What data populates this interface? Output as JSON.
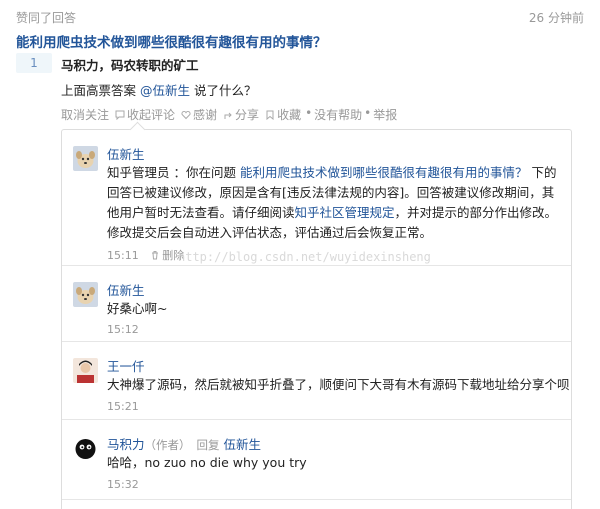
{
  "activity": {
    "label": "赞同了回答",
    "time": "26 分钟前"
  },
  "question": {
    "title": "能利用爬虫技术做到哪些很酷很有趣很有用的事情？"
  },
  "answer": {
    "votes": "1",
    "author": "马积力，码农转职的矿工",
    "text_prefix": "上面高票答案 ",
    "mention": "@伍新生",
    "text_suffix": " 说了什么？"
  },
  "actions": {
    "unfollow": "取消关注",
    "collapse_comments": "收起评论",
    "thanks": "感谢",
    "share": "分享",
    "favorite": "收藏",
    "dot": "•",
    "no_help": "没有帮助",
    "report": "举报"
  },
  "comments": [
    {
      "author": "伍新生",
      "text_a": "知乎管理员 ：你在问题 ",
      "link_a": "能利用爬虫技术做到哪些很酷很有趣很有用的事情？",
      "text_b": " 下的回答已被建议修改，原因是含有[违反法律法规的内容]。回答被建议修改期间，其他用户暂时无法查看。请仔细阅读",
      "link_b": "知乎社区管理规定",
      "text_c": "，并对提示的部分作出修改。修改提交后会自动进入评估状态，评估通过后会恢复正常。",
      "time": "15:11",
      "delete": "删除"
    },
    {
      "author": "伍新生",
      "text": "好桑心啊~",
      "time": "15:12"
    },
    {
      "author": "王一仟",
      "text": "大神爆了源码，然后就被知乎折叠了，顺便问下大哥有木有源码下载地址给分享个呗",
      "time": "15:21"
    },
    {
      "author": "马积力",
      "author_tag": "（作者）",
      "reply_word": "回复",
      "reply_to": "伍新生",
      "text": "哈哈，no zuo no die why you try",
      "time": "15:32"
    }
  ],
  "watermark": "http://blog.csdn.net/wuyidexinsheng"
}
